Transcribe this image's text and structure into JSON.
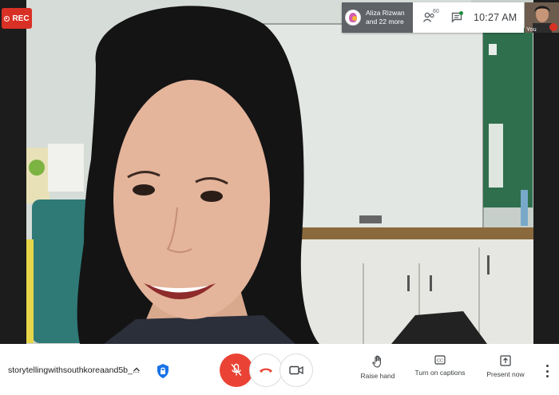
{
  "recording": {
    "label": "REC"
  },
  "top_bar": {
    "participant_name": "Aliza Rizwan",
    "participant_more": "and 22 more",
    "people_count": "60",
    "time": "10:27 AM"
  },
  "self_view": {
    "label": "You"
  },
  "meeting": {
    "name": "storytellingwithsouthkoreaand5b_..."
  },
  "controls": {
    "raise_hand": "Raise hand",
    "captions": "Turn on captions",
    "present": "Present now"
  },
  "colors": {
    "rec_red": "#d93025",
    "mic_off_red": "#ea4335",
    "chip_gray": "#5f6368"
  },
  "icons": [
    "record-icon",
    "people-icon",
    "chat-icon",
    "chevron-up-icon",
    "shield-lock-icon",
    "mic-off-icon",
    "hang-up-icon",
    "camera-icon",
    "hand-icon",
    "captions-icon",
    "present-icon",
    "more-vert-icon"
  ]
}
